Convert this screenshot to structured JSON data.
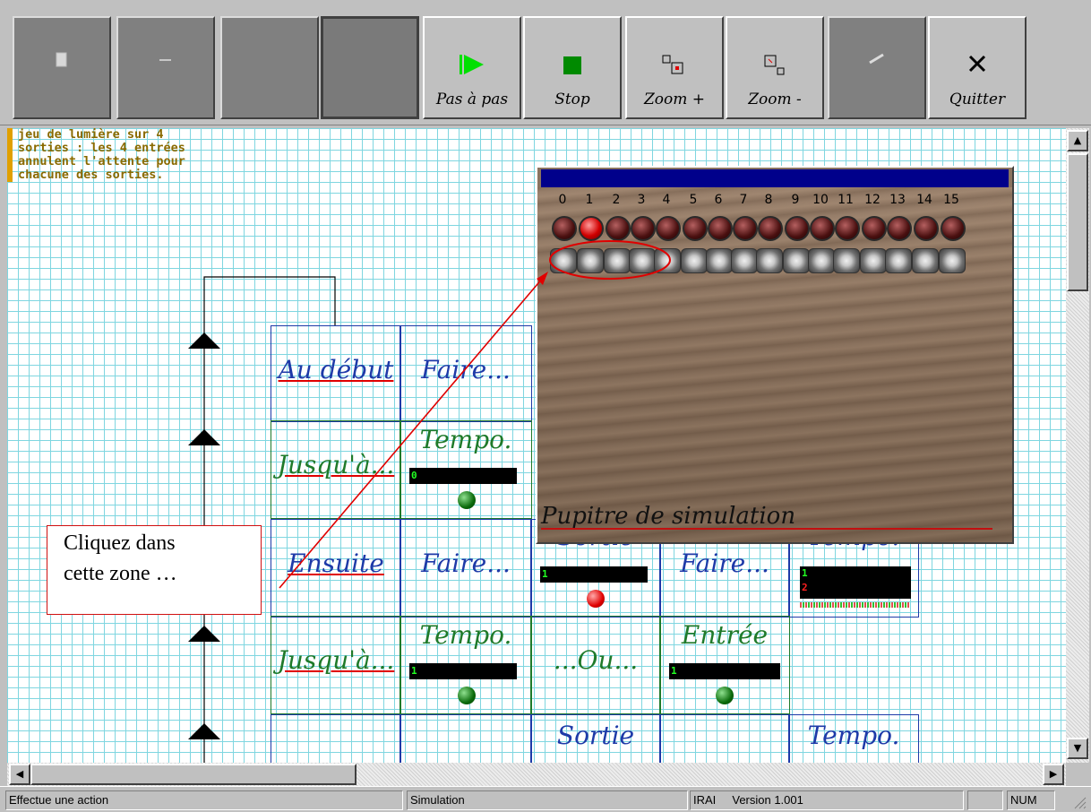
{
  "toolbar": {
    "buttons": [
      {
        "label": "",
        "icon": "document-icon",
        "enabled": false
      },
      {
        "label": "",
        "icon": "key-icon",
        "enabled": false
      },
      {
        "label": "",
        "icon": "",
        "enabled": false
      },
      {
        "label": "",
        "icon": "",
        "enabled": false
      },
      {
        "label": "Pas à pas",
        "icon": "step-play-icon",
        "enabled": true
      },
      {
        "label": "Stop",
        "icon": "stop-icon",
        "enabled": true
      },
      {
        "label": "Zoom +",
        "icon": "zoom-in-icon",
        "enabled": true
      },
      {
        "label": "Zoom -",
        "icon": "zoom-out-icon",
        "enabled": true
      },
      {
        "label": "",
        "icon": "pen-icon",
        "enabled": false
      },
      {
        "label": "Quitter",
        "icon": "close-icon",
        "enabled": true
      }
    ]
  },
  "program": {
    "comment": "jeu de lumière sur 4\nsorties : les 4 entrées\nannulent l'attente pour\nchacune des sorties.",
    "labels": {
      "au_debut": "Au début",
      "faire": "Faire...",
      "jusqua": "Jusqu'à...",
      "tempo": "Tempo.",
      "ensuite": "Ensuite",
      "sortie": "Sortie",
      "ou": "...Ou...",
      "entree": "Entrée",
      "ensuite_partial": "Ensuite"
    },
    "bars": {
      "tempo1": "0",
      "sortie1": "1",
      "tempo_r1a": "1",
      "tempo_r1b": "2",
      "tempo2": "1",
      "entree1": "1"
    }
  },
  "simulator": {
    "caption": "Pupitre de simulation",
    "channels": [
      "0",
      "1",
      "2",
      "3",
      "4",
      "5",
      "6",
      "7",
      "8",
      "9",
      "10",
      "11",
      "12",
      "13",
      "14",
      "15"
    ],
    "lit_outputs": [
      "1"
    ]
  },
  "callout": {
    "line1": "Cliquez dans",
    "line2": "cette zone …"
  },
  "statusbar": {
    "message": "Effectue une action",
    "mode": "Simulation",
    "product": "IRAI",
    "version": "Version 1.001",
    "num": "NUM"
  },
  "colors": {
    "grid": "#7fd6e0",
    "logic_blue": "#1e3aa8",
    "logic_green": "#1f7a2a",
    "highlight_red": "#e00000",
    "sim_titlebar": "#00008b"
  }
}
